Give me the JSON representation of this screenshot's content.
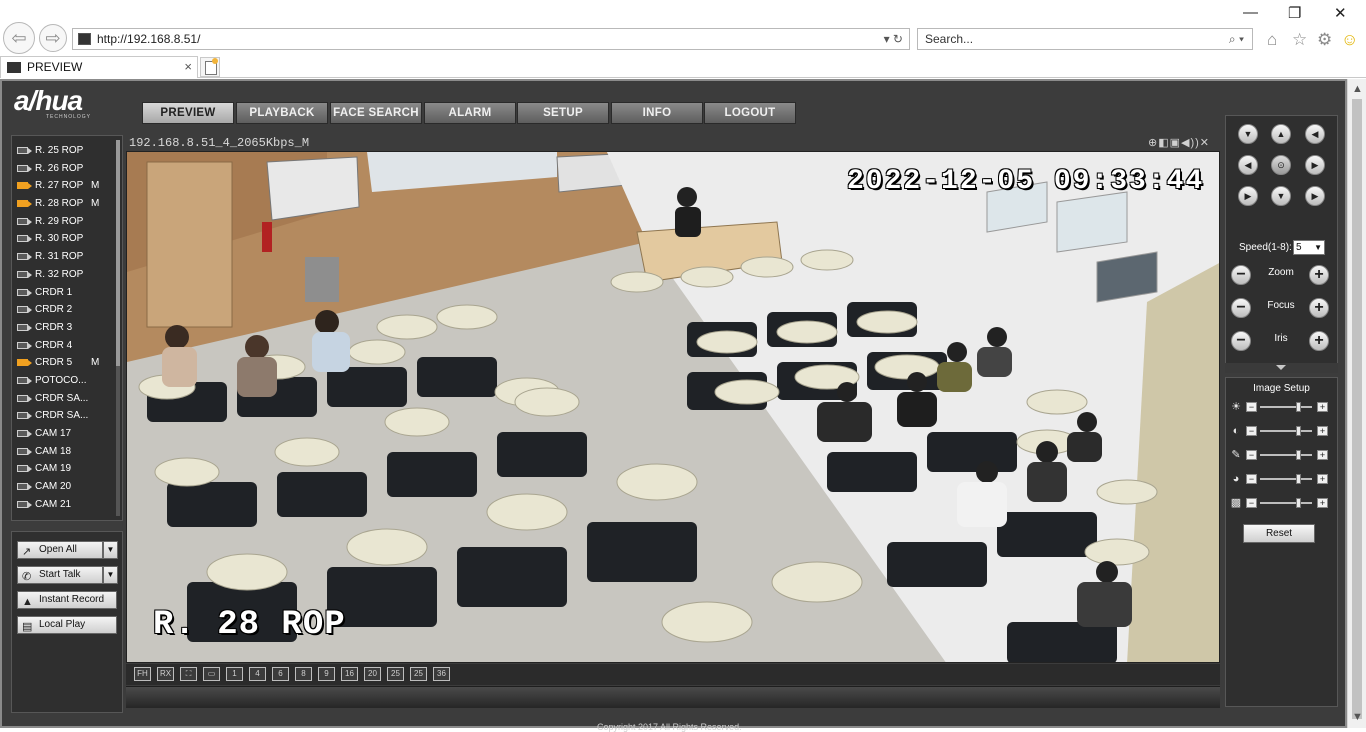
{
  "browser": {
    "url": "http://192.168.8.51/",
    "search_placeholder": "Search...",
    "tab_title": "PREVIEW",
    "tab_close": "×",
    "address_tools": "▾ ↻",
    "search_tools": "⌕ ▾",
    "window_controls": {
      "minimize": "—",
      "restore": "❐",
      "close": "✕"
    },
    "toolbar_icons": {
      "home": "⌂",
      "favorites": "☆",
      "settings": "⚙",
      "feedback": "☺"
    },
    "back_glyph": "⇦",
    "forward_glyph": "⇨"
  },
  "app": {
    "logo": "a/hua",
    "logo_sub": "TECHNOLOGY",
    "nav": [
      "PREVIEW",
      "PLAYBACK",
      "FACE SEARCH",
      "ALARM",
      "SETUP",
      "INFO",
      "LOGOUT"
    ],
    "active_nav": "PREVIEW"
  },
  "channels": [
    {
      "label": "R. 25 ROP",
      "open": false,
      "mark": ""
    },
    {
      "label": "R. 26 ROP",
      "open": false,
      "mark": ""
    },
    {
      "label": "R. 27 ROP",
      "open": true,
      "mark": "M"
    },
    {
      "label": "R. 28 ROP",
      "open": true,
      "mark": "M"
    },
    {
      "label": "R. 29 ROP",
      "open": false,
      "mark": ""
    },
    {
      "label": "R. 30 ROP",
      "open": false,
      "mark": ""
    },
    {
      "label": "R. 31 ROP",
      "open": false,
      "mark": ""
    },
    {
      "label": "R. 32 ROP",
      "open": false,
      "mark": ""
    },
    {
      "label": "CRDR 1",
      "open": false,
      "mark": ""
    },
    {
      "label": "CRDR 2",
      "open": false,
      "mark": ""
    },
    {
      "label": "CRDR 3",
      "open": false,
      "mark": ""
    },
    {
      "label": "CRDR 4",
      "open": false,
      "mark": ""
    },
    {
      "label": "CRDR 5",
      "open": true,
      "mark": "M"
    },
    {
      "label": "POTOCO...",
      "open": false,
      "mark": ""
    },
    {
      "label": "CRDR SA...",
      "open": false,
      "mark": ""
    },
    {
      "label": "CRDR SA...",
      "open": false,
      "mark": ""
    },
    {
      "label": "CAM 17",
      "open": false,
      "mark": ""
    },
    {
      "label": "CAM 18",
      "open": false,
      "mark": ""
    },
    {
      "label": "CAM 19",
      "open": false,
      "mark": ""
    },
    {
      "label": "CAM 20",
      "open": false,
      "mark": ""
    },
    {
      "label": "CAM 21",
      "open": false,
      "mark": ""
    }
  ],
  "actions": {
    "open_all": "Open All",
    "start_talk": "Start Talk",
    "instant_record": "Instant Record",
    "local_play": "Local Play",
    "dropdown_glyph": "▼",
    "icons": {
      "open_all": "↗",
      "start_talk": "✆",
      "instant_record": "▲",
      "local_play": "▤"
    }
  },
  "video": {
    "header": "192.168.8.51_4_2065Kbps_M",
    "tools": "⊕◧▣◀))✕",
    "osd_time": "2022-12-05 09:33:44",
    "osd_name": "R. 28 ROP",
    "layouts": [
      "FH",
      "RX",
      "⛶",
      "▭",
      "1",
      "4",
      "6",
      "8",
      "9",
      "16",
      "20",
      "25",
      "25",
      "36"
    ]
  },
  "ptz": {
    "dirs": [
      "▼",
      "▲",
      "◀",
      "◀",
      "⊙",
      "▶",
      "▶",
      "▼",
      "▶"
    ],
    "speed_label": "Speed(1-8):",
    "speed_value": "5",
    "speed_arrow": "▼",
    "zoom": "Zoom",
    "focus": "Focus",
    "iris": "Iris",
    "minus": "−",
    "plus": "+"
  },
  "image_setup": {
    "title": "Image Setup",
    "rows": [
      {
        "icon": "☀",
        "level": 0.75
      },
      {
        "icon": "◐",
        "level": 0.75
      },
      {
        "icon": "✎",
        "level": 0.75
      },
      {
        "icon": "◕",
        "level": 0.75
      },
      {
        "icon": "▩",
        "level": 0.75
      }
    ],
    "minus": "−",
    "plus": "+",
    "reset": "Reset"
  },
  "footer": "Copyright 2017 All Rights Reserved."
}
